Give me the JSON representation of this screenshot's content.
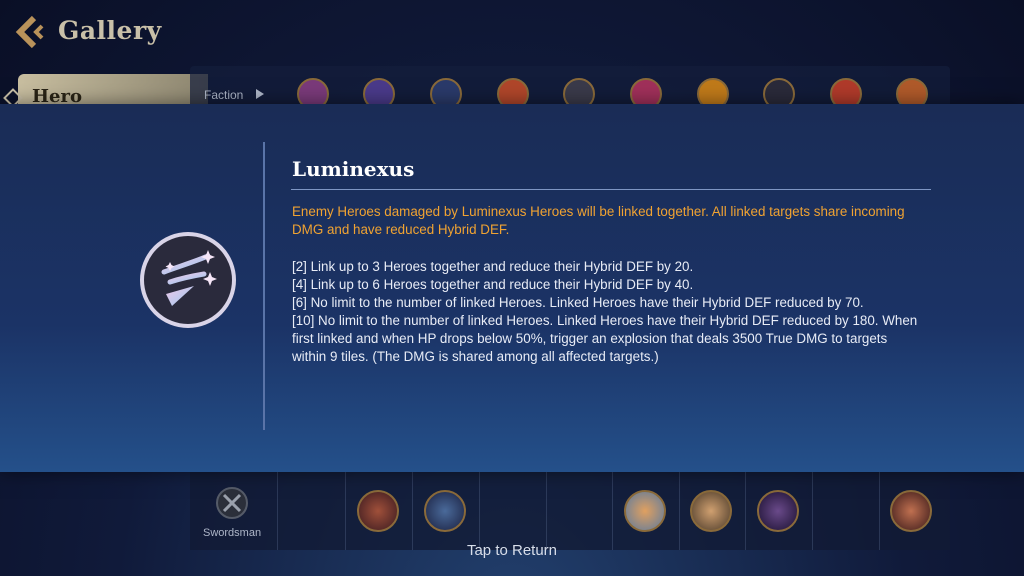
{
  "header": {
    "title": "Gallery"
  },
  "nav": {
    "active_item": "Hero"
  },
  "faction_bar": {
    "label": "Faction",
    "icons": [
      "faction-icon-1",
      "faction-icon-2",
      "faction-icon-3",
      "faction-icon-4",
      "faction-icon-5",
      "faction-icon-6",
      "faction-icon-7",
      "faction-icon-8",
      "faction-icon-9",
      "faction-icon-10"
    ]
  },
  "faction_detail": {
    "name": "Luminexus",
    "description": "Enemy Heroes damaged by Luminexus Heroes will be linked together. All linked targets share incoming DMG and have reduced Hybrid DEF.",
    "tiers": [
      "[2] Link up to 3 Heroes together and reduce their Hybrid DEF by 20.",
      "[4] Link up to 6 Heroes together and reduce their Hybrid DEF by 40.",
      "[6] No limit to the number of linked Heroes. Linked Heroes have their Hybrid DEF reduced by 70.",
      "[10] No limit to the number of linked Heroes. Linked Heroes have their Hybrid DEF reduced by 180. When first linked and when HP drops below 50%, trigger an explosion that deals 3500 True DMG to targets within 9 tiles. (The DMG is shared among all affected targets.)"
    ],
    "colors": {
      "description": "#f0a332",
      "tiers": "#e8ecf6"
    }
  },
  "roster": {
    "role_label": "Swordsman"
  },
  "footer": {
    "tap_to_return": "Tap to Return"
  }
}
